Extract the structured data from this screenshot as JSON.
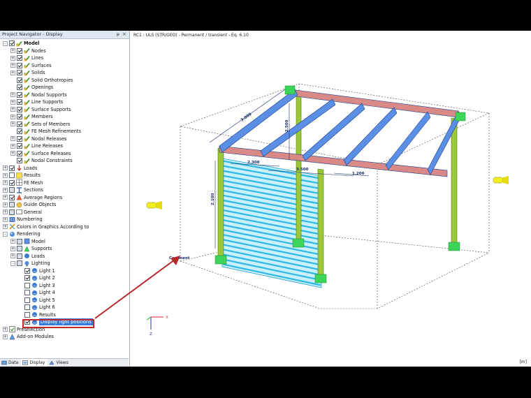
{
  "navigator": {
    "title": "Project Navigator - Display",
    "pin": "ᵽ",
    "close": "×",
    "tabs": [
      {
        "label": "Data"
      },
      {
        "label": "Display"
      },
      {
        "label": "Views"
      }
    ],
    "tree": [
      {
        "label": "Model",
        "level": 0,
        "exp": "-",
        "cb": "on",
        "icon": "check-icon",
        "bold": true
      },
      {
        "label": "Nodes",
        "level": 1,
        "exp": "+",
        "cb": "on",
        "icon": "check-icon"
      },
      {
        "label": "Lines",
        "level": 1,
        "exp": "+",
        "cb": "on",
        "icon": "check-icon"
      },
      {
        "label": "Surfaces",
        "level": 1,
        "exp": "+",
        "cb": "on",
        "icon": "check-icon"
      },
      {
        "label": "Solids",
        "level": 1,
        "exp": "+",
        "cb": "on",
        "icon": "check-icon"
      },
      {
        "label": "Solid Orthotropies",
        "level": 1,
        "exp": "",
        "cb": "on",
        "icon": "check-icon"
      },
      {
        "label": "Openings",
        "level": 1,
        "exp": "",
        "cb": "on",
        "icon": "check-icon"
      },
      {
        "label": "Nodal Supports",
        "level": 1,
        "exp": "+",
        "cb": "on",
        "icon": "check-icon"
      },
      {
        "label": "Line Supports",
        "level": 1,
        "exp": "+",
        "cb": "on",
        "icon": "check-icon"
      },
      {
        "label": "Surface Supports",
        "level": 1,
        "exp": "+",
        "cb": "on",
        "icon": "check-icon"
      },
      {
        "label": "Members",
        "level": 1,
        "exp": "+",
        "cb": "on",
        "icon": "check-icon"
      },
      {
        "label": "Sets of Members",
        "level": 1,
        "exp": "+",
        "cb": "on",
        "icon": "check-icon"
      },
      {
        "label": "FE Mesh Refinements",
        "level": 1,
        "exp": "",
        "cb": "on",
        "icon": "check-icon"
      },
      {
        "label": "Nodal Releases",
        "level": 1,
        "exp": "+",
        "cb": "on",
        "icon": "check-icon"
      },
      {
        "label": "Line Releases",
        "level": 1,
        "exp": "+",
        "cb": "on",
        "icon": "check-icon"
      },
      {
        "label": "Surface Releases",
        "level": 1,
        "exp": "+",
        "cb": "on",
        "icon": "check-icon"
      },
      {
        "label": "Nodal Constraints",
        "level": 1,
        "exp": "",
        "cb": "on",
        "icon": "check-icon"
      },
      {
        "label": "Loads",
        "level": 0,
        "exp": "+",
        "cb": "on",
        "icon": "loads-icon"
      },
      {
        "label": "Results",
        "level": 0,
        "exp": "+",
        "cb": "off",
        "icon": "results-icon"
      },
      {
        "label": "FE Mesh",
        "level": 0,
        "exp": "+",
        "cb": "on",
        "icon": "mesh-icon"
      },
      {
        "label": "Sections",
        "level": 0,
        "exp": "+",
        "cb": "part",
        "icon": "sections-icon"
      },
      {
        "label": "Average Regions",
        "level": 0,
        "exp": "+",
        "cb": "on",
        "icon": "regions-icon"
      },
      {
        "label": "Guide Objects",
        "level": 0,
        "exp": "+",
        "cb": "part",
        "icon": "guide-icon"
      },
      {
        "label": "General",
        "level": 0,
        "exp": "+",
        "cb": "part",
        "icon": "general-icon"
      },
      {
        "label": "Numbering",
        "level": 0,
        "exp": "+",
        "cb": "none",
        "icon": "numbering-icon"
      },
      {
        "label": "Colors in Graphics According to",
        "level": 0,
        "exp": "+",
        "cb": "none",
        "icon": "colors-icon"
      },
      {
        "label": "Rendering",
        "level": 0,
        "exp": "-",
        "cb": "none",
        "icon": "rendering-icon"
      },
      {
        "label": "Model",
        "level": 1,
        "exp": "+",
        "cb": "part",
        "icon": "render-model-icon"
      },
      {
        "label": "Supports",
        "level": 1,
        "exp": "+",
        "cb": "part",
        "icon": "render-supports-icon"
      },
      {
        "label": "Loads",
        "level": 1,
        "exp": "+",
        "cb": "part",
        "icon": "render-loads-icon"
      },
      {
        "label": "Lighting",
        "level": 1,
        "exp": "-",
        "cb": "part",
        "icon": "lighting-icon"
      },
      {
        "label": "Light 1",
        "level": 2,
        "exp": "",
        "cb": "on",
        "icon": "light-icon"
      },
      {
        "label": "Light 2",
        "level": 2,
        "exp": "",
        "cb": "on",
        "icon": "light-icon"
      },
      {
        "label": "Light 3",
        "level": 2,
        "exp": "",
        "cb": "off",
        "icon": "light-icon"
      },
      {
        "label": "Light 4",
        "level": 2,
        "exp": "",
        "cb": "off",
        "icon": "light-icon"
      },
      {
        "label": "Light 5",
        "level": 2,
        "exp": "",
        "cb": "off",
        "icon": "light-icon"
      },
      {
        "label": "Light 6",
        "level": 2,
        "exp": "",
        "cb": "off",
        "icon": "light-icon"
      },
      {
        "label": "Results",
        "level": 2,
        "exp": "",
        "cb": "off",
        "icon": "light-icon"
      },
      {
        "label": "Display light positions",
        "level": 2,
        "exp": "",
        "cb": "on",
        "icon": "light-icon",
        "selected": true
      },
      {
        "label": "Preselection",
        "level": 0,
        "exp": "+",
        "cb": "none",
        "icon": "preselection-icon"
      },
      {
        "label": "Add-on Modules",
        "level": 0,
        "exp": "+",
        "cb": "none",
        "icon": "addon-icon"
      }
    ]
  },
  "viewport": {
    "title": "RC1 : ULS (STR/GEO) - Permanent / transient - Eq. 6.10",
    "badge": "[m]",
    "labels": {
      "comment": "Comment",
      "dim_3000": "3.000",
      "dim_2300": "2.300",
      "dim_3500": "3.500",
      "dim_1200": "1.200",
      "dim_2500": "2.500",
      "dim_2100": "2.100",
      "axis_x": "X",
      "axis_z": "Z"
    }
  },
  "colors": {
    "beam_blue": "#5b8fe6",
    "beam_red": "#d98a86",
    "column_green": "#9bc83a",
    "support_green": "#3ed45a",
    "shutter_cyan": "#4fcfee",
    "light_yellow": "#f2ee22",
    "annotation_red": "#c0292b",
    "selection_blue": "#3479d9"
  }
}
